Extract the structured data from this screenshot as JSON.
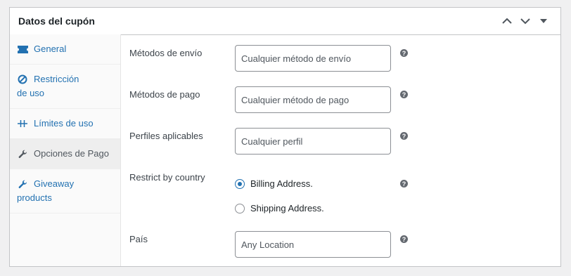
{
  "panel": {
    "title": "Datos del cupón"
  },
  "tabs": [
    {
      "label": "General",
      "icon": "ticket-icon"
    },
    {
      "label": "Restricción de uso",
      "line1": "Restricción",
      "line2": "de uso",
      "icon": "block-icon"
    },
    {
      "label": "Límites de uso",
      "icon": "limit-icon"
    },
    {
      "label": "Opciones de Pago",
      "icon": "wrench-icon",
      "active": true
    },
    {
      "label": "Giveaway products",
      "line1": "Giveaway",
      "line2": "products",
      "icon": "wrench-icon"
    }
  ],
  "fields": {
    "shipping_methods": {
      "label": "Métodos de envío",
      "placeholder": "Cualquier método de envío"
    },
    "payment_methods": {
      "label": "Métodos de pago",
      "placeholder": "Cualquier método de pago"
    },
    "profiles": {
      "label": "Perfiles aplicables",
      "placeholder": "Cualquier perfil"
    },
    "restrict_country": {
      "label": "Restrict by country",
      "options": [
        {
          "label": "Billing Address.",
          "checked": true
        },
        {
          "label": "Shipping Address.",
          "checked": false
        }
      ]
    },
    "country": {
      "label": "País",
      "placeholder": "Any Location"
    }
  },
  "colors": {
    "accent": "#2271b1",
    "border": "#c3c4c7"
  }
}
